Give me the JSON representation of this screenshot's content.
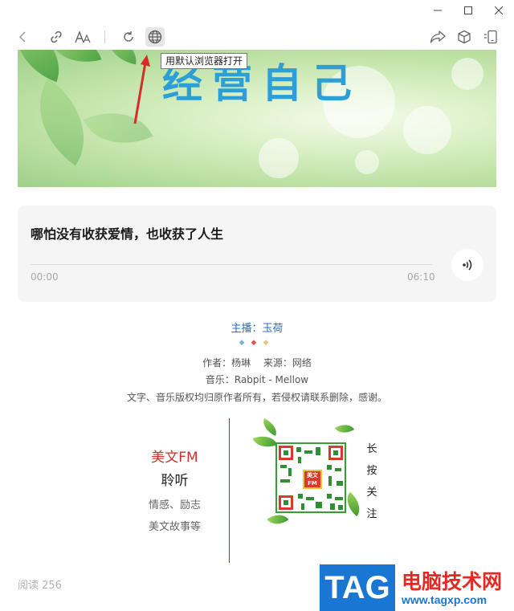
{
  "toolbar": {
    "icons": [
      "back-icon",
      "link-icon",
      "font-size-icon",
      "refresh-icon",
      "globe-icon",
      "share-icon",
      "cube-icon",
      "phone-icon"
    ],
    "tooltip": "用默认浏览器打开"
  },
  "banner": {
    "title": "经营自己"
  },
  "audio": {
    "title": "哪怕没有收获爱情，也收获了人生",
    "current_time": "00:00",
    "duration": "06:10",
    "progress": 0,
    "play_icon": "audio-wave-icon"
  },
  "credits": {
    "anchor": "主播：玉荷",
    "author_line": "作者：杨琳　 来源：网络",
    "music_line": "音乐：Rabpit - Mellow",
    "copyright_line": "文字、音乐版权均归原作者所有，若侵权请联系删除，感谢。"
  },
  "promo": {
    "brand": "美文FM",
    "listen": "聆听",
    "tag1": "情感、励志",
    "tag2": "美文故事等",
    "qr_logo": "美文FM",
    "vertical": "长按关注"
  },
  "footer": {
    "read_count": "阅读 256"
  },
  "watermark": {
    "logo": "TAG",
    "title": "电脑技术网",
    "url": "www.tagxp.com"
  },
  "colors": {
    "accent_blue": "#2a6fb5",
    "brand_red": "#c8322a",
    "divider_red": "#b22a24",
    "watermark_blue": "#1976d2",
    "watermark_red": "#e12a23"
  }
}
